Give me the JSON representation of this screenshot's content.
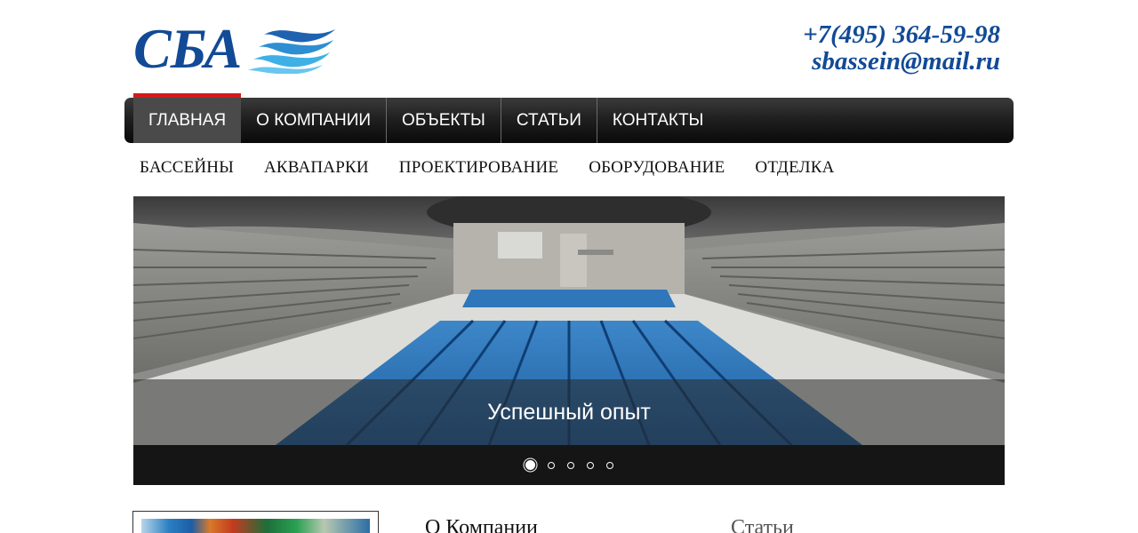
{
  "header": {
    "logo_text": "СБА",
    "phone": "+7(495) 364-59-98",
    "email": "sbassein@mail.ru"
  },
  "main_nav": {
    "items": [
      {
        "label": "ГЛАВНАЯ",
        "active": true
      },
      {
        "label": "О КОМПАНИИ",
        "active": false
      },
      {
        "label": "ОБЪЕКТЫ",
        "active": false
      },
      {
        "label": "СТАТЬИ",
        "active": false
      },
      {
        "label": "КОНТАКТЫ",
        "active": false
      }
    ]
  },
  "sub_nav": {
    "items": [
      {
        "label": "БАССЕЙНЫ"
      },
      {
        "label": "АКВАПАРКИ"
      },
      {
        "label": "ПРОЕКТИРОВАНИЕ"
      },
      {
        "label": "ОБОРУДОВАНИЕ"
      },
      {
        "label": "ОТДЕЛКА"
      }
    ]
  },
  "slider": {
    "caption": "Успешный опыт",
    "slide_count": 5,
    "active_index": 0
  },
  "sections": {
    "about_title": "О Компании",
    "articles_title": "Статьи"
  },
  "colors": {
    "brand_blue": "#124a96",
    "nav_active_accent": "#d11b1b",
    "nav_bg": "#1a1a1a"
  }
}
